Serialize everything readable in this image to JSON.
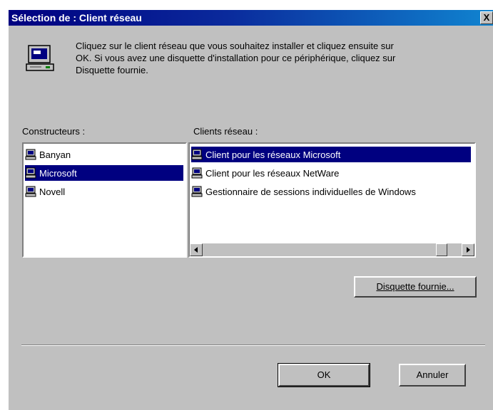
{
  "window": {
    "title": "Sélection de : Client réseau",
    "close_label": "X"
  },
  "intro_text": "Cliquez sur le client réseau que vous souhaitez installer et cliquez ensuite sur\nOK. Si vous avez une disquette d'installation pour ce périphérique, cliquez sur\nDisquette fournie.",
  "manufacturers": {
    "label": "Constructeurs :",
    "items": [
      {
        "label": "Banyan",
        "selected": false,
        "icon": "network-icon"
      },
      {
        "label": "Microsoft",
        "selected": true,
        "icon": "network-icon"
      },
      {
        "label": "Novell",
        "selected": false,
        "icon": "network-icon"
      }
    ]
  },
  "clients": {
    "label": "Clients réseau :",
    "items": [
      {
        "label": "Client pour les réseaux Microsoft",
        "selected": true,
        "icon": "network-icon"
      },
      {
        "label": "Client pour les réseaux NetWare",
        "selected": false,
        "icon": "network-icon"
      },
      {
        "label": "Gestionnaire de sessions individuelles de Windows",
        "selected": false,
        "icon": "network-icon"
      }
    ]
  },
  "buttons": {
    "have_disk": "Disquette fournie...",
    "ok": "OK",
    "cancel": "Annuler"
  },
  "colors": {
    "selection": "#000080",
    "face": "#c0c0c0"
  }
}
